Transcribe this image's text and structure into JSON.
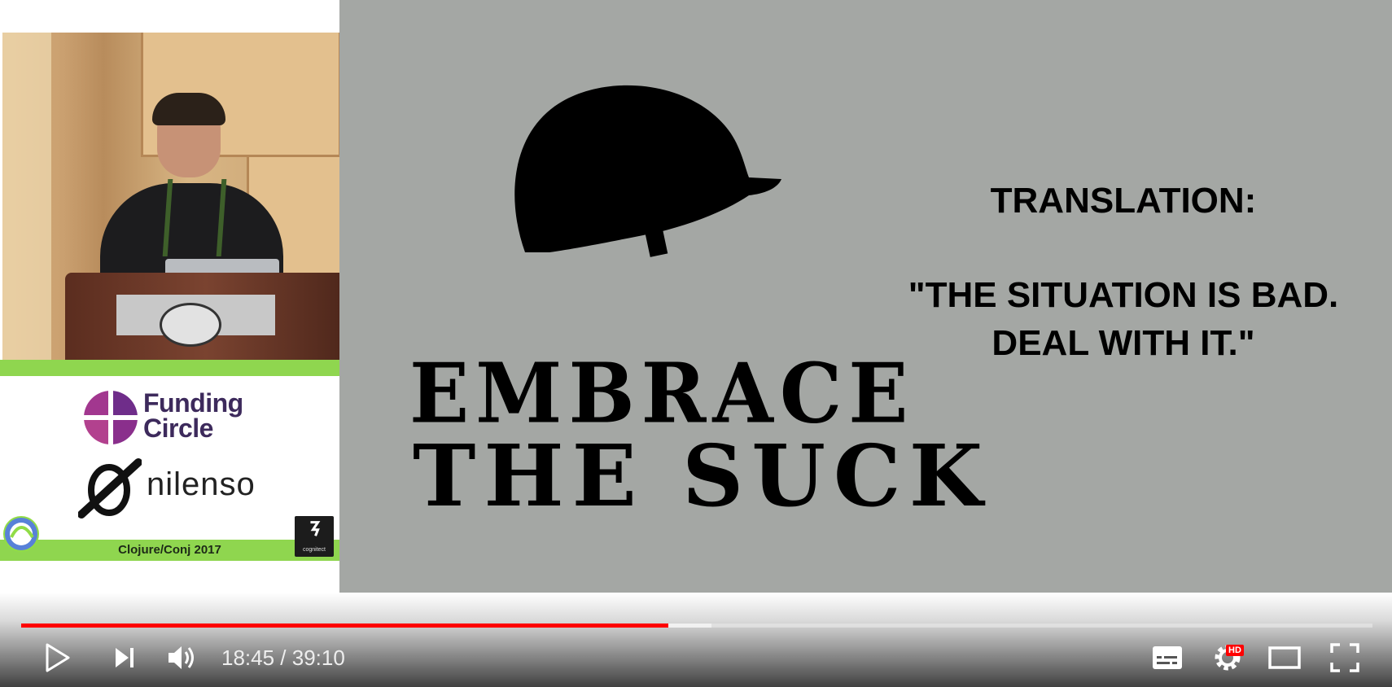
{
  "sidebar": {
    "sponsor_1_line1": "Funding",
    "sponsor_1_line2": "Circle",
    "sponsor_2": "nilenso",
    "conference": "Clojure/Conj 2017",
    "cognitect": "cognitect"
  },
  "slide": {
    "embrace": "EMBRACE",
    "the_suck": "THE SUCK",
    "translation": "TRANSLATION:",
    "quote_line1": "\"THE SITUATION IS BAD.",
    "quote_line2": "DEAL WITH IT.\""
  },
  "player": {
    "current_time": "18:45",
    "duration": "39:10",
    "time_display": "18:45 / 39:10",
    "progress_fraction": 0.479,
    "buffered_fraction": 0.511,
    "hd_badge": "HD",
    "accent_color": "#ff0000",
    "icons": [
      "play-icon",
      "next-icon",
      "volume-icon",
      "subtitles-icon",
      "settings-icon",
      "theater-mode-icon",
      "fullscreen-icon"
    ]
  }
}
